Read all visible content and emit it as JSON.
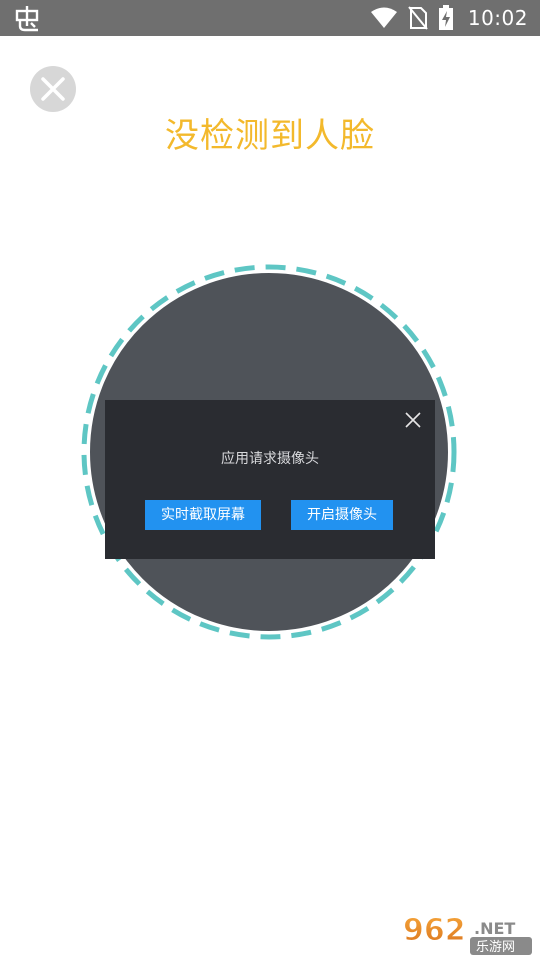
{
  "status_bar": {
    "app_icon": "bug-app-icon",
    "icons": [
      "wifi-icon",
      "no-sim-icon",
      "battery-charging-icon"
    ],
    "time": "10:02"
  },
  "close_button": {
    "icon": "close-icon"
  },
  "title": "没检测到人脸",
  "scan_ring": {
    "dash_color": "#5ec6c4",
    "fill_color": "#4f5359"
  },
  "dialog": {
    "message": "应用请求摄像头",
    "close_icon": "close-icon",
    "buttons": [
      {
        "label": "实时截取屏幕"
      },
      {
        "label": "开启摄像头"
      }
    ]
  },
  "colors": {
    "status_bar": "#6f6f6f",
    "title": "#f3b92c",
    "dialog_bg": "#2a2c31",
    "button": "#2292f0"
  },
  "watermark": {
    "brand": "962.NET",
    "brand_cn": "乐游网"
  }
}
